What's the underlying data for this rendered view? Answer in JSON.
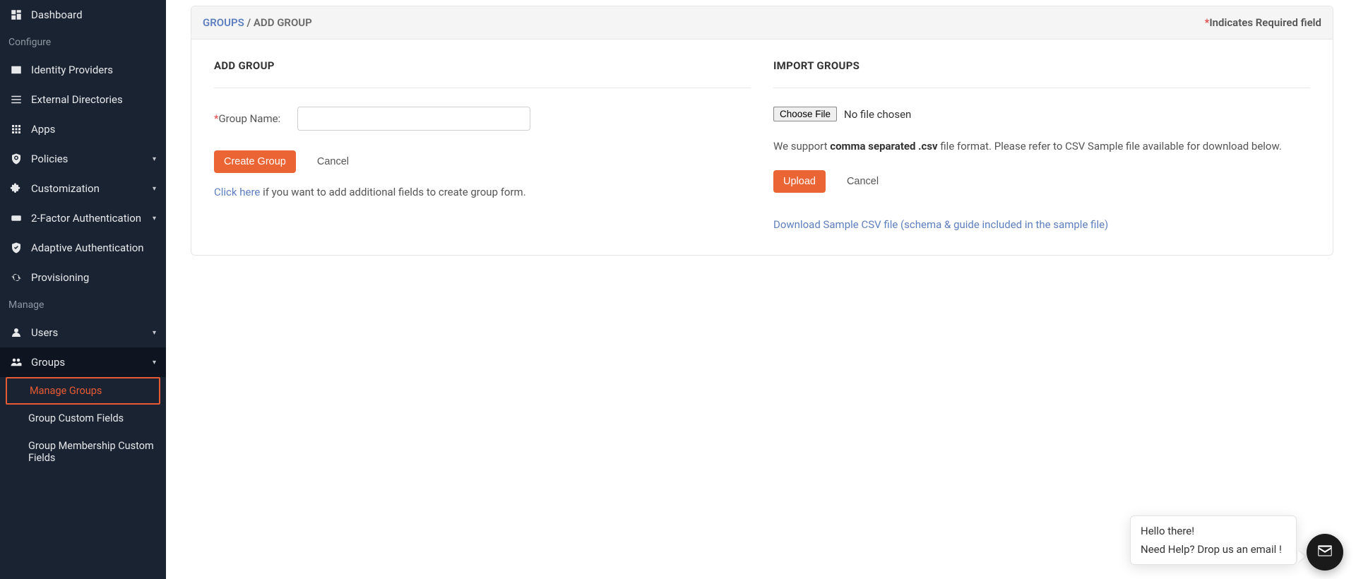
{
  "sidebar": {
    "items": [
      {
        "label": "Dashboard"
      },
      {
        "section": "Configure"
      },
      {
        "label": "Identity Providers"
      },
      {
        "label": "External Directories"
      },
      {
        "label": "Apps"
      },
      {
        "label": "Policies",
        "expandable": true
      },
      {
        "label": "Customization",
        "expandable": true
      },
      {
        "label": "2-Factor Authentication",
        "expandable": true
      },
      {
        "label": "Adaptive Authentication"
      },
      {
        "label": "Provisioning"
      },
      {
        "section": "Manage"
      },
      {
        "label": "Users",
        "expandable": true
      },
      {
        "label": "Groups",
        "expandable": true,
        "active": true
      }
    ],
    "group_subitems": [
      {
        "label": "Manage Groups",
        "highlight": true
      },
      {
        "label": "Group Custom Fields"
      },
      {
        "label": "Group Membership Custom Fields"
      }
    ]
  },
  "breadcrumb": {
    "root": "GROUPS",
    "sep": "/",
    "current": "ADD GROUP"
  },
  "required_note": {
    "ast": "*",
    "text": "Indicates Required field"
  },
  "add_group": {
    "title": "ADD GROUP",
    "field_ast": "*",
    "field_label": "Group Name:",
    "create_btn": "Create Group",
    "cancel_btn": "Cancel",
    "hint_link": "Click here",
    "hint_rest": " if you want to add additional fields to create group form."
  },
  "import_groups": {
    "title": "IMPORT GROUPS",
    "choose_file": "Choose File",
    "no_file": "No file chosen",
    "support_pre": "We support ",
    "support_bold": "comma separated .csv",
    "support_post": " file format. Please refer to CSV Sample file available for download below.",
    "upload_btn": "Upload",
    "cancel_btn": "Cancel",
    "download_link": "Download Sample CSV file (schema & guide included in the sample file)"
  },
  "chat": {
    "line1": "Hello there!",
    "line2": "Need Help? Drop us an email !"
  }
}
